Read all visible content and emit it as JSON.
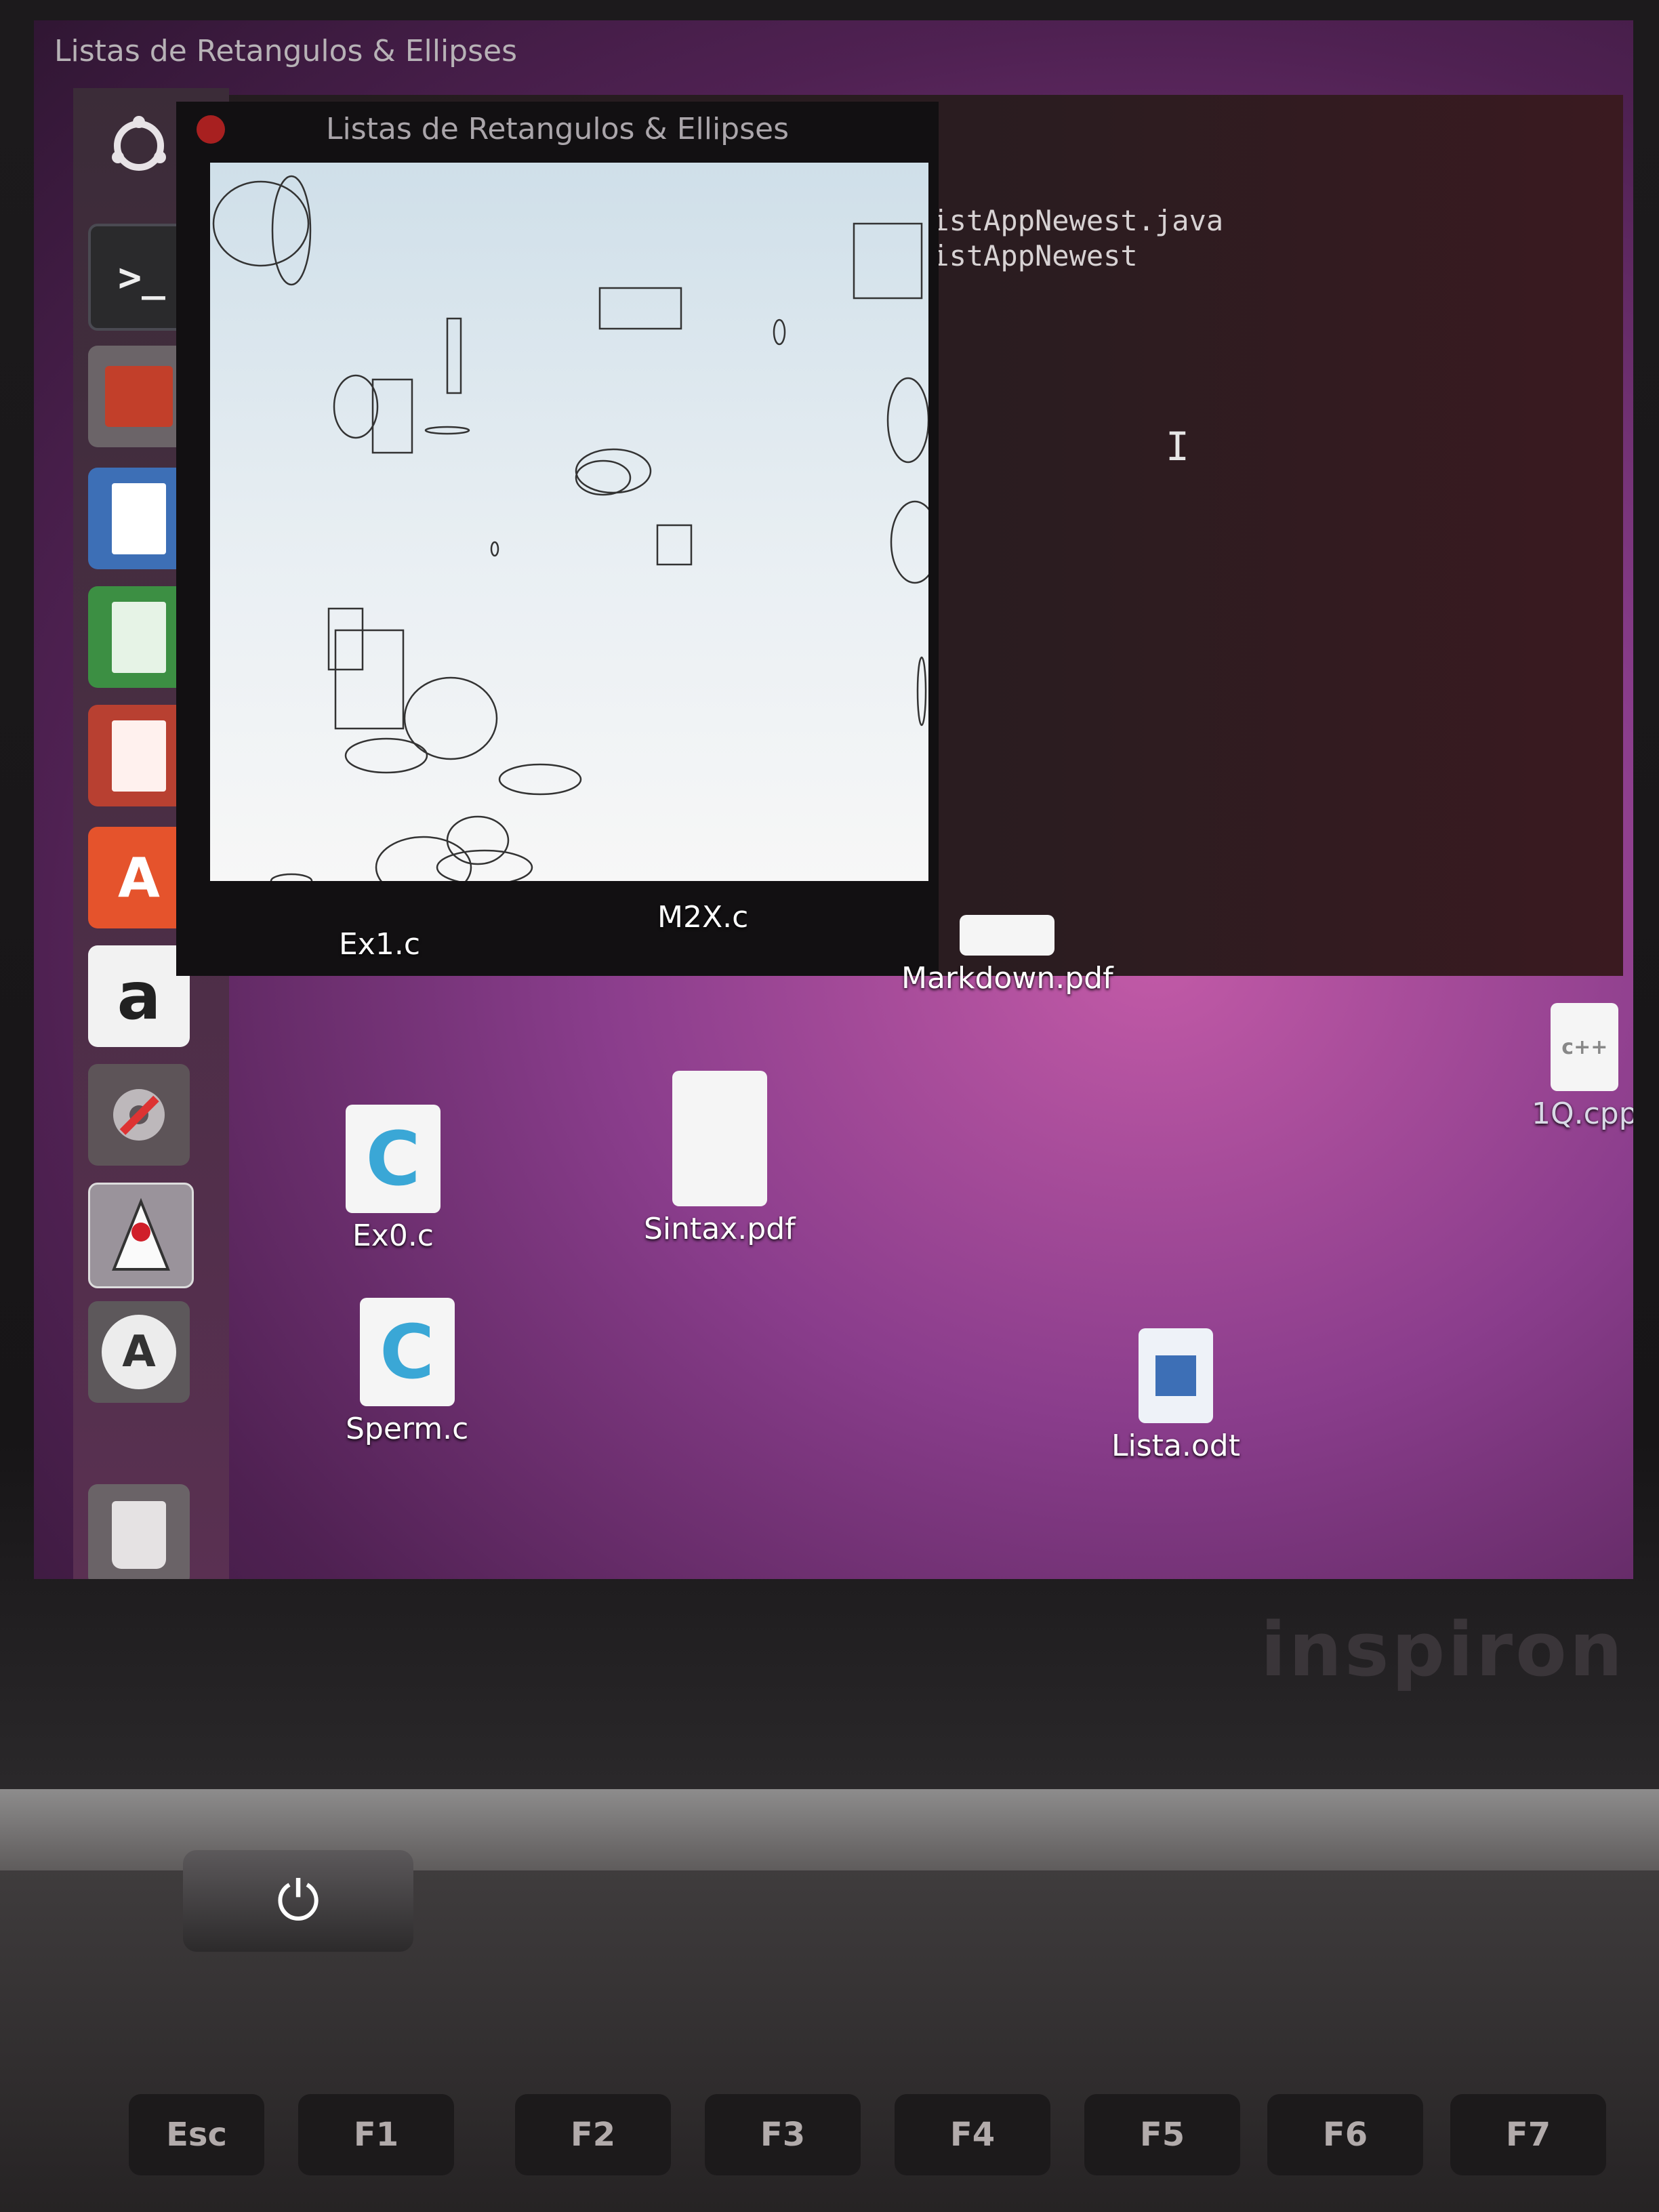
{
  "screen": {
    "top_title": "Listas de Retangulos & Ellipses"
  },
  "java_window": {
    "title": "Listas de Retangulos & Ellipses"
  },
  "terminal": {
    "lines": [
      "ListAppNewest.java",
      "ListAppNewest"
    ]
  },
  "launcher": {
    "items": [
      {
        "name": "ubuntu-logo-icon"
      },
      {
        "name": "terminal-icon",
        "glyph": ">_"
      },
      {
        "name": "files-icon"
      },
      {
        "name": "writer-icon"
      },
      {
        "name": "calc-icon"
      },
      {
        "name": "impress-icon"
      },
      {
        "name": "software-center-icon",
        "glyph": "A"
      },
      {
        "name": "amazon-icon",
        "glyph": "a"
      },
      {
        "name": "system-settings-icon"
      },
      {
        "name": "java-duke-icon"
      },
      {
        "name": "software-updater-icon",
        "glyph": "A"
      },
      {
        "name": "trash-icon"
      }
    ]
  },
  "desktop_icons": [
    {
      "label": "Ex1.c"
    },
    {
      "label": "M2X.c"
    },
    {
      "label": "Markdown.pdf"
    },
    {
      "label": "1Q.cpp"
    },
    {
      "label": "Ex0.c"
    },
    {
      "label": "Sintax.pdf"
    },
    {
      "label": "Sperm.c"
    },
    {
      "label": "Lista.odt"
    }
  ],
  "laptop": {
    "brand": "inspiron"
  },
  "keyboard": {
    "keys": [
      "Esc",
      "F1",
      "F2",
      "F3",
      "F4",
      "F5",
      "F6",
      "F7"
    ]
  }
}
